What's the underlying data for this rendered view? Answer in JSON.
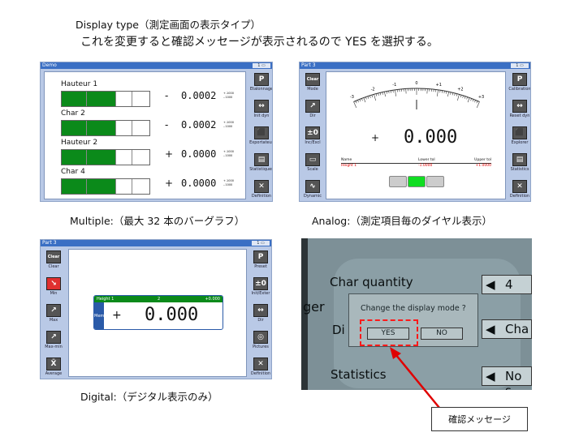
{
  "header": {
    "title": "Display type（測定画面の表示タイプ）",
    "subtitle": "これを変更すると確認メッセージが表示されるので YES を選択する。"
  },
  "captions": {
    "multiple": "Multiple:（最大 32 本のバーグラフ）",
    "analog": "Analog:（測定項目毎のダイヤル表示）",
    "digital": "Digital:（デジタル表示のみ）"
  },
  "multiple": {
    "window_title": "Demo",
    "rows": [
      {
        "name": "Hauteur 1",
        "sign": "-",
        "value": "0.0002",
        "tol_up": "+.1000",
        "tol_low": "-.1000"
      },
      {
        "name": "Char 2",
        "sign": "-",
        "value": "0.0002",
        "tol_up": "+.1000",
        "tol_low": "-.1000"
      },
      {
        "name": "Hauteur 2",
        "sign": "+",
        "value": "0.0000",
        "tol_up": "+.1000",
        "tol_low": "-.1000"
      },
      {
        "name": "Char 4",
        "sign": "+",
        "value": "0.0000",
        "tol_up": "+.1000",
        "tol_low": "-.1000"
      }
    ],
    "right_menu": [
      "Etalonnage",
      "Init dyn",
      "Exportateur",
      "Statistiques",
      "Definition",
      "Mesure"
    ],
    "right_icons": [
      "P",
      "↔",
      "⬛",
      "▤",
      "✕",
      "M"
    ]
  },
  "analog": {
    "window_title": "Part 3",
    "left_menu": [
      "Mode",
      "Dir",
      "Inc/Excl",
      "Scale",
      "Dynamic",
      "Stop"
    ],
    "left_icons": [
      "Clear",
      "↗",
      "±0",
      "▭",
      "∿",
      "STOP"
    ],
    "right_menu": [
      "Calibration",
      "Reset dyn",
      "Explorer",
      "Statistics",
      "Definition",
      "Measure"
    ],
    "right_icons": [
      "P",
      "↔",
      "⬛",
      "▤",
      "✕",
      "M"
    ],
    "scale_labels": [
      "-3",
      "-2",
      "-1",
      "0",
      "+1",
      "+2",
      "+3"
    ],
    "sign": "+",
    "value": "0.000",
    "table_headers": [
      "Name",
      "Lower tol",
      "Upper tol"
    ],
    "table_row": [
      "Height 1",
      "-1.0000",
      "+1.0000"
    ]
  },
  "digital": {
    "window_title": "Part 3",
    "left_menu": [
      "Clear",
      "Min",
      "Max",
      "Max-min",
      "Average",
      "Median"
    ],
    "left_icons": [
      "Clear",
      "↘",
      "↗",
      "↗",
      "X̄",
      "≡"
    ],
    "right_menu": [
      "Preset",
      "Init/Exter",
      "Dir",
      "Pictures",
      "Definition",
      "Print"
    ],
    "right_icons": [
      "P",
      "±0",
      "↔",
      "◎",
      "✕",
      "▭"
    ],
    "header": [
      "Height 1",
      "2",
      "+0.000"
    ],
    "side_label": "Mem",
    "sign": "+",
    "value": "0.000"
  },
  "photo": {
    "rows": [
      "Char quantity",
      "Di",
      "Statistics"
    ],
    "right_values": [
      "4",
      "Cha",
      "No s"
    ],
    "left_fragment": "ger",
    "dialog_text": "Change the display mode ?",
    "yes": "YES",
    "no": "NO"
  },
  "callout": "確認メッセージ",
  "colors": {
    "screen_bg": "#b9c9e6",
    "green_bar": "#0b8a1a",
    "accent_red": "#e00000",
    "title_blue": "#3a6fc4"
  }
}
